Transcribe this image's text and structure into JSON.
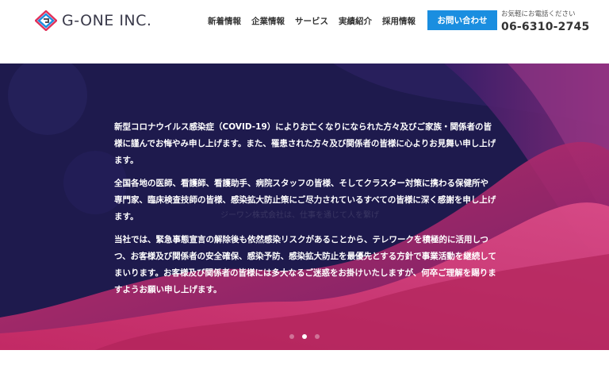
{
  "header": {
    "logo_text": "G-ONE INC.",
    "nav": [
      {
        "label": "新着情報"
      },
      {
        "label": "企業情報"
      },
      {
        "label": "サービス"
      },
      {
        "label": "実績紹介"
      },
      {
        "label": "採用情報"
      }
    ],
    "contact_label": "お問い合わせ",
    "phone_caption": "お気軽にお電話ください",
    "phone_number": "06-6310-2745"
  },
  "hero": {
    "paragraphs": [
      "新型コロナウイルス感染症（COVID-19）によりお亡くなりになられた方々及びご家族・関係者の皆様に謹んでお悔やみ申し上げます。また、罹患された方々及び関係者の皆様に心よりお見舞い申し上げます。",
      "全国各地の医師、看護師、看護助手、病院スタッフの皆様、そしてクラスター対策に携わる保健所や専門家、臨床検査技師の皆様、感染拡大防止策にご尽力されているすべての皆様に深く感謝を申し上げます。",
      "当社では、緊急事態宣言の解除後も依然感染リスクがあることから、テレワークを積極的に活用しつつ、お客様及び関係者の安全確保、感染予防、感染拡大防止を最優先とする方針で事業活動を継続してまいります。お客様及び関係者の皆様には多大なるご迷惑をお掛けいたしますが、何卒ご理解を賜りますようお願い申し上げます。"
    ],
    "watermark": "ジーワン株式会社は、仕事を通じて人を繋げ",
    "slides": 3,
    "active_slide": 1
  },
  "colors": {
    "accent": "#1a8ee0",
    "hero_bg": "#1e1a4d",
    "wave_pink": "#d6336c"
  }
}
